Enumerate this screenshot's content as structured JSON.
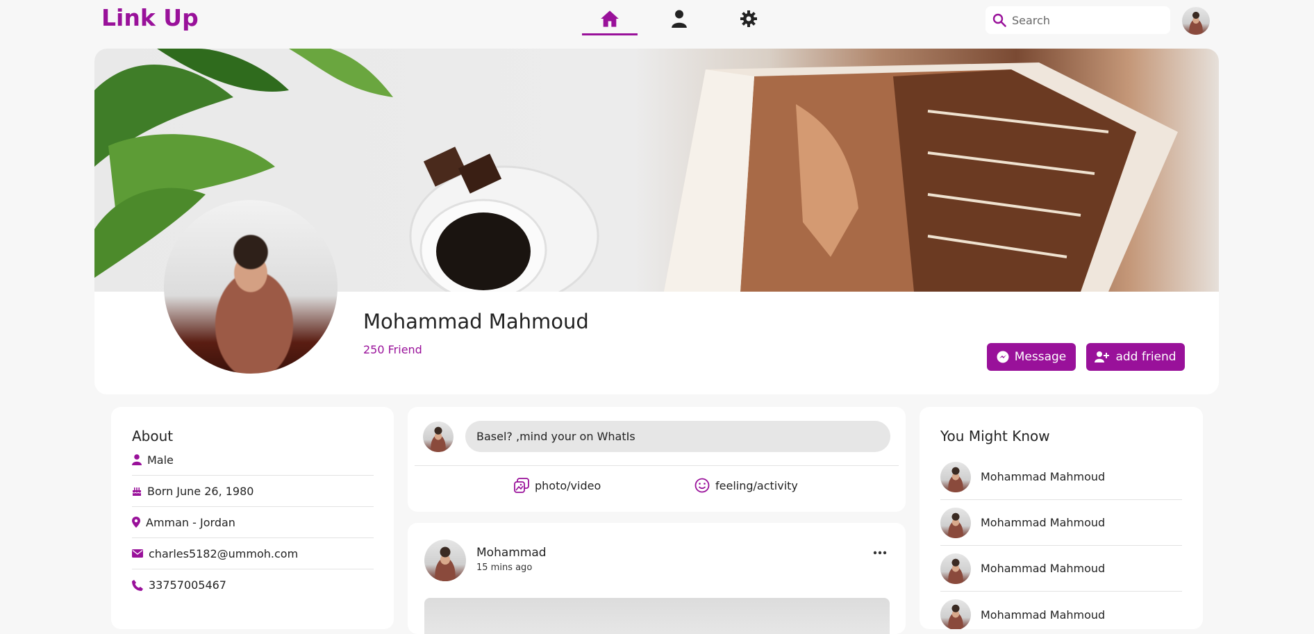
{
  "header": {
    "logo": "Link Up",
    "search_placeholder": "Search",
    "accent_color": "#99119a",
    "nav": [
      {
        "icon": "home-icon",
        "active": true
      },
      {
        "icon": "user-icon",
        "active": false
      },
      {
        "icon": "gear-icon",
        "active": false
      }
    ]
  },
  "profile": {
    "name": "Mohammad Mahmoud",
    "friends": "250 Friend",
    "message_label": "Message",
    "add_friend_label": "add friend"
  },
  "about": {
    "title": "About",
    "items": [
      {
        "icon": "user-icon",
        "text": "Male"
      },
      {
        "icon": "cake-icon",
        "text": "Born June 26, 1980"
      },
      {
        "icon": "location-pin-icon",
        "text": "Amman - Jordan"
      },
      {
        "icon": "envelope-icon",
        "text": "charles5182@ummoh.com"
      },
      {
        "icon": "phone-icon",
        "text": "33757005467"
      }
    ]
  },
  "composer": {
    "input_value": "Basel? ,mind your on WhatIs",
    "actions": [
      {
        "icon": "image-icon",
        "label": "photo/video"
      },
      {
        "icon": "smile-icon",
        "label": "feeling/activity"
      }
    ]
  },
  "post": {
    "author": "Mohammad",
    "time": "15 mins ago"
  },
  "suggestions": {
    "title": "You Might Know",
    "people": [
      {
        "name": "Mohammad Mahmoud"
      },
      {
        "name": "Mohammad Mahmoud"
      },
      {
        "name": "Mohammad Mahmoud"
      },
      {
        "name": "Mohammad Mahmoud"
      }
    ]
  }
}
